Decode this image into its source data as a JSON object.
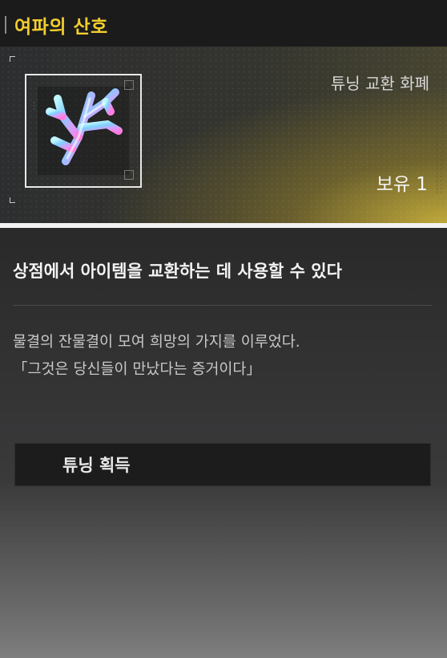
{
  "item": {
    "name": "여파의 산호",
    "category": "튜닝 교환 화폐",
    "held_label": "보유 1",
    "icon": "coral-icon",
    "accent_color": "#f2cd2e"
  },
  "description": {
    "summary": "상점에서 아이템을 교환하는 데 사용할 수 있다",
    "flavor_line1": "물결의 잔물결이 모여 희망의 가지를 이루었다.",
    "flavor_line2": "「그것은 당신들이 만났다는 증거이다」"
  },
  "source": {
    "label": "튜닝 획득"
  }
}
